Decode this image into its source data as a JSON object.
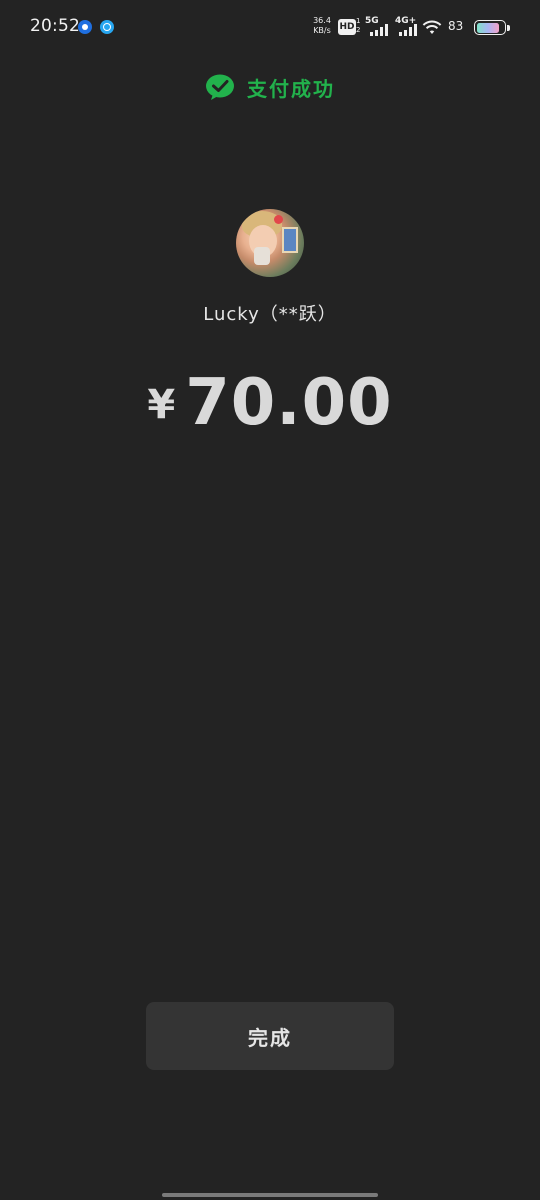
{
  "status_bar": {
    "time": "20:52",
    "net_speed_value": "36.4",
    "net_speed_unit": "KB/s",
    "hd_label": "HD",
    "hd_sub_top": "1",
    "hd_sub_bottom": "2",
    "network_1": "5G",
    "network_2": "4G+",
    "battery_percent": "83",
    "battery_level": 0.83,
    "notification_icons": [
      "app-notification-icon",
      "sync-notification-icon"
    ]
  },
  "header": {
    "title": "支付成功",
    "icon": "wechat-icon",
    "accent_color": "#22b24c"
  },
  "recipient": {
    "name": "Lucky（**跃）"
  },
  "payment": {
    "currency_symbol": "¥",
    "amount": "70.00"
  },
  "actions": {
    "done_label": "完成"
  },
  "theme": {
    "background": "#232323",
    "button_background": "#343434"
  }
}
